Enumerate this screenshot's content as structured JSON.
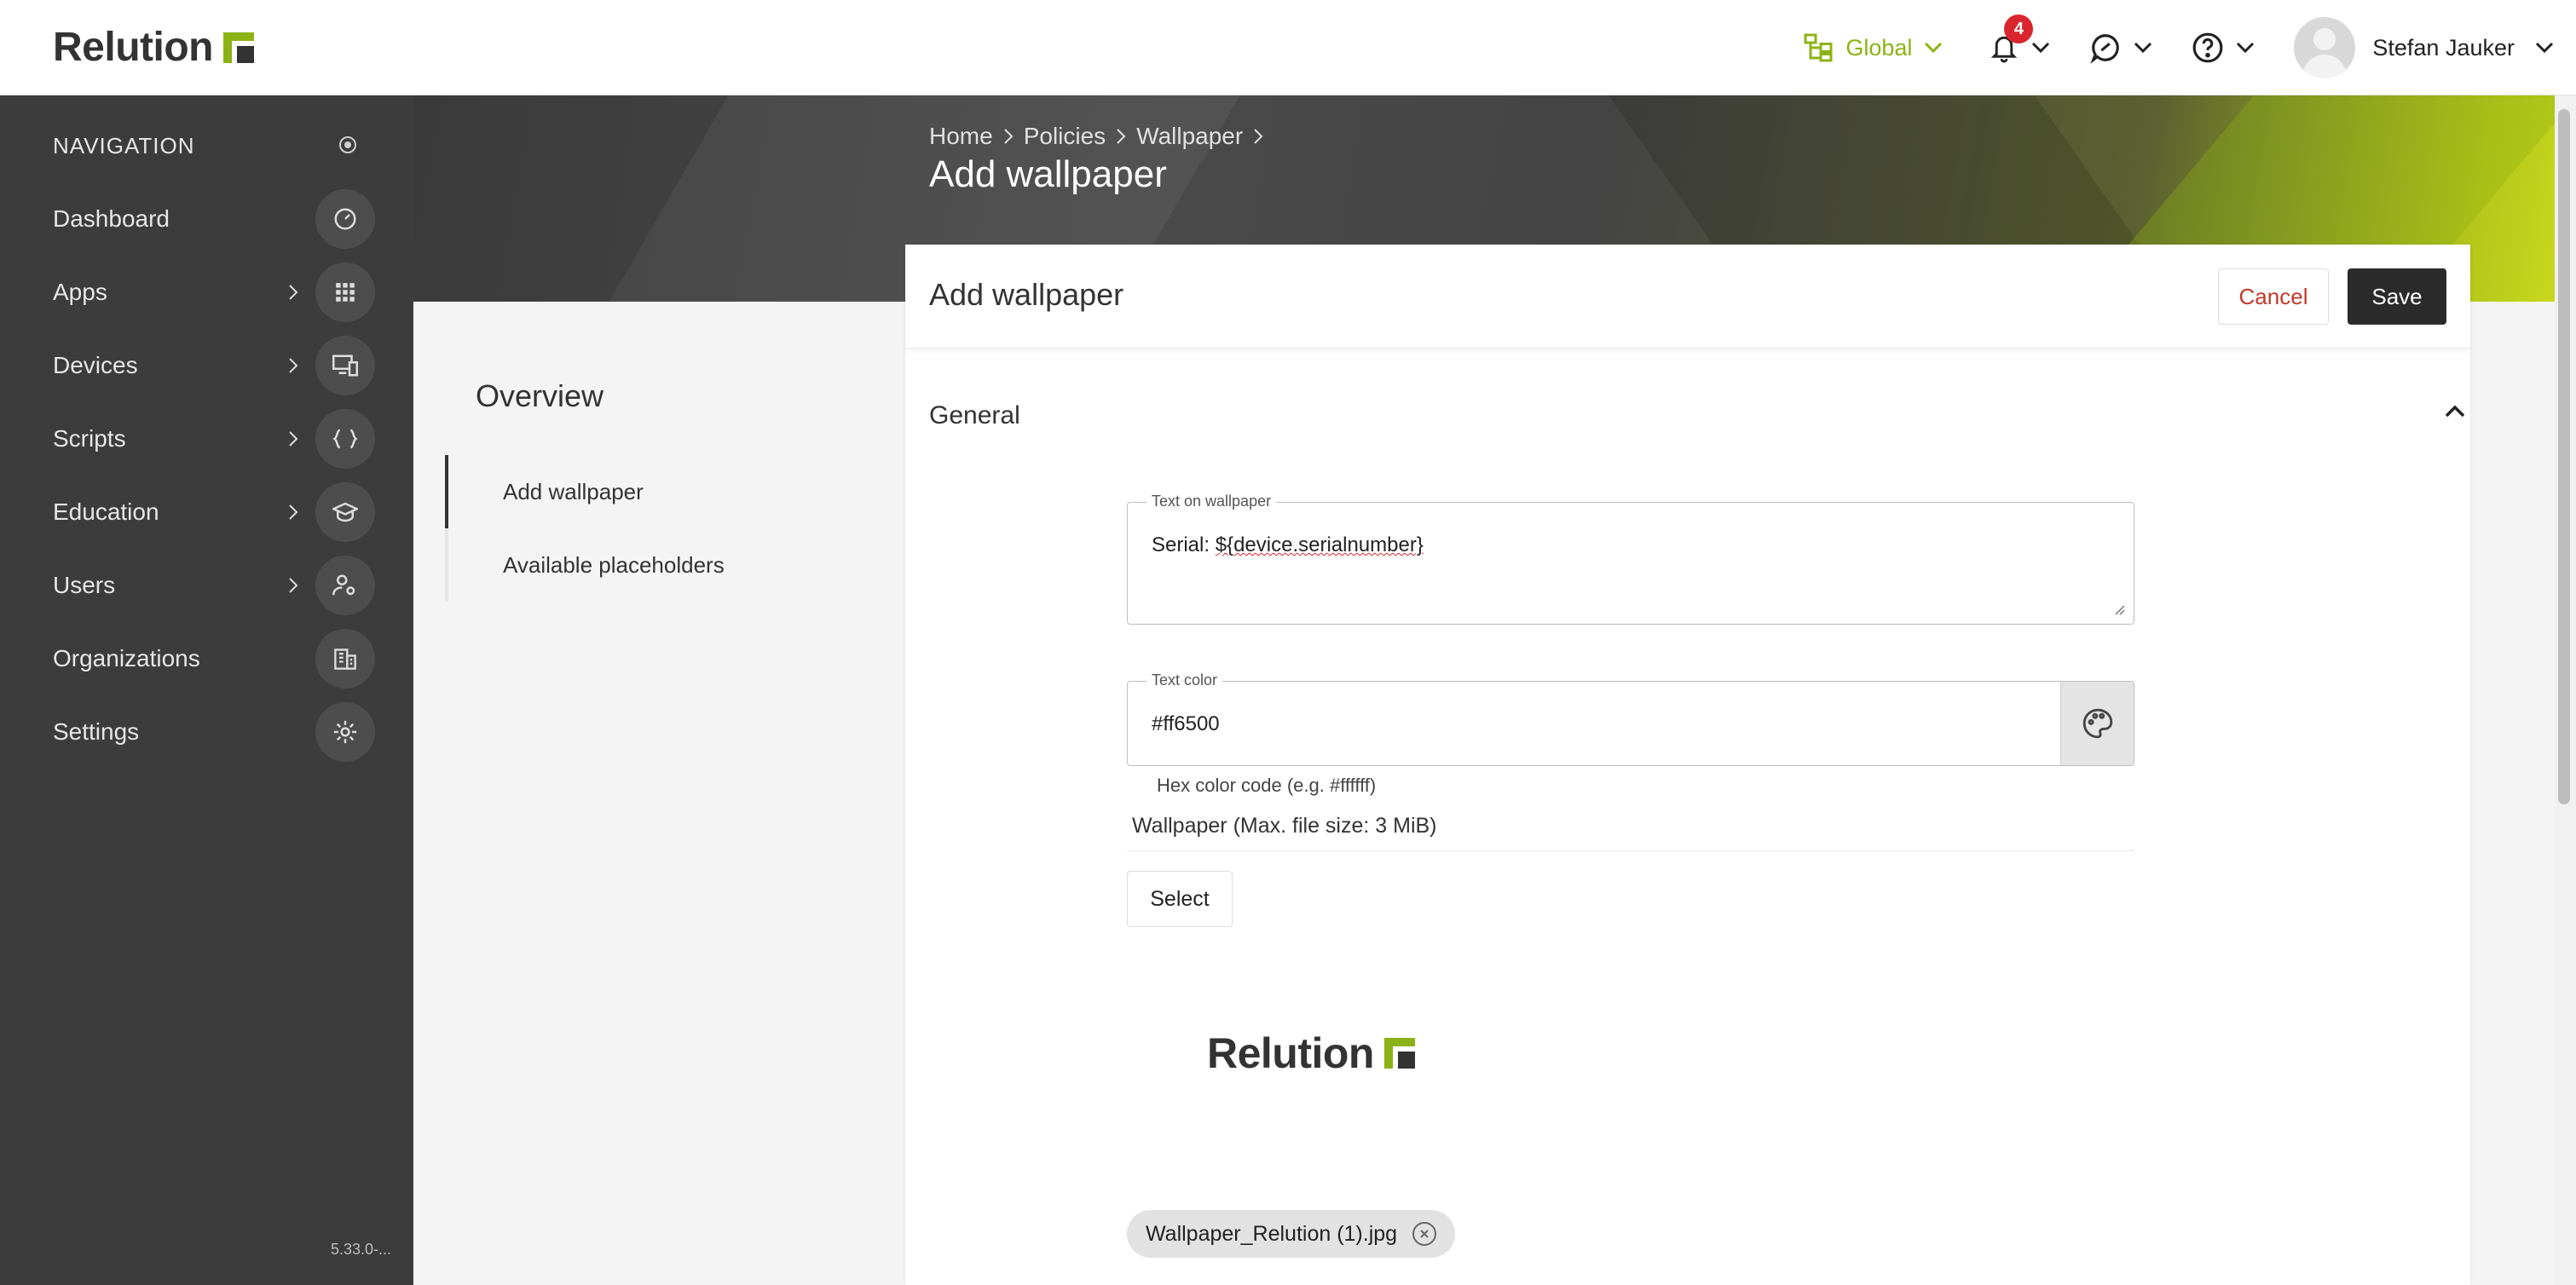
{
  "app": {
    "logo_text": "Relution"
  },
  "header": {
    "org_label": "Global",
    "notification_count": "4",
    "user_name": "Stefan Jauker"
  },
  "sidebar": {
    "header": "NAVIGATION",
    "items": [
      {
        "label": "Dashboard",
        "icon": "gauge-icon"
      },
      {
        "label": "Apps",
        "icon": "grid-icon"
      },
      {
        "label": "Devices",
        "icon": "devices-icon"
      },
      {
        "label": "Scripts",
        "icon": "code-braces-icon"
      },
      {
        "label": "Education",
        "icon": "graduation-cap-icon"
      },
      {
        "label": "Users",
        "icon": "users-icon"
      },
      {
        "label": "Organizations",
        "icon": "building-icon"
      },
      {
        "label": "Settings",
        "icon": "gear-icon"
      }
    ],
    "version": "5.33.0-..."
  },
  "breadcrumb": {
    "home": "Home",
    "policies": "Policies",
    "wallpaper": "Wallpaper"
  },
  "page": {
    "title": "Add wallpaper"
  },
  "overview": {
    "title": "Overview",
    "items": [
      "Add wallpaper",
      "Available placeholders"
    ]
  },
  "card": {
    "title": "Add wallpaper",
    "cancel_label": "Cancel",
    "save_label": "Save",
    "section_title": "General",
    "text_field": {
      "label": "Text on wallpaper",
      "value_prefix": "Serial: ",
      "value_placeholder": "${device.serialnumber}"
    },
    "color_field": {
      "label": "Text color",
      "value": "#ff6500",
      "hint": "Hex color code (e.g. #ffffff)"
    },
    "file": {
      "label": "Wallpaper (Max. file size: 3 MiB)",
      "select_label": "Select",
      "preview_logo_text": "Relution",
      "file_name": "Wallpaper_Relution (1).jpg"
    }
  },
  "colors": {
    "accent": "#8cb315",
    "sidebar_bg": "#3c3c3c",
    "cancel_text": "#c0392b",
    "save_bg": "#2b2b2b",
    "badge": "#d9262e"
  }
}
